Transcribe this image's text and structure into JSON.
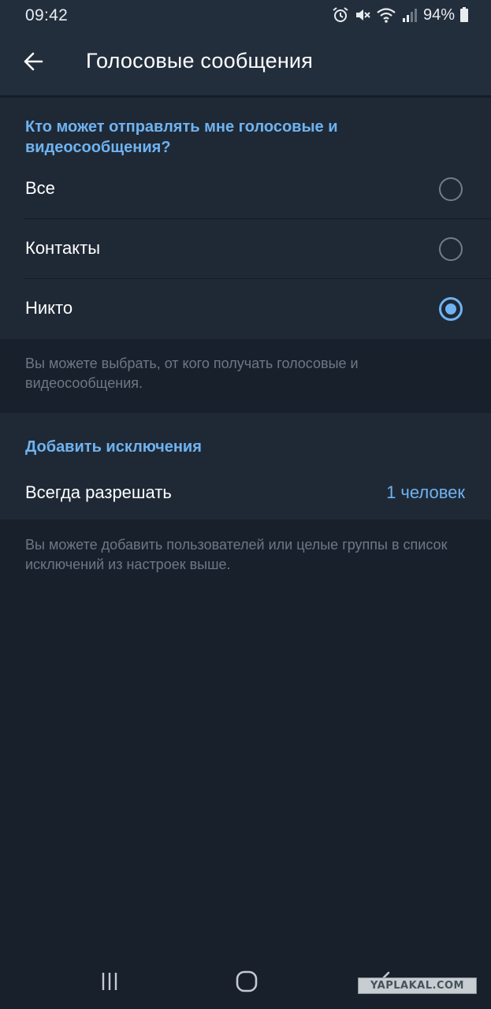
{
  "status_bar": {
    "time": "09:42",
    "battery": "94%",
    "icons": [
      "alarm-icon",
      "mute-icon",
      "wifi-icon",
      "signal-icon",
      "battery-icon"
    ]
  },
  "app_bar": {
    "title": "Голосовые сообщения",
    "back_icon": "arrow-left-icon"
  },
  "privacy": {
    "header": "Кто может отправлять мне голосовые и видеосообщения?",
    "options": [
      {
        "label": "Все",
        "selected": false
      },
      {
        "label": "Контакты",
        "selected": false
      },
      {
        "label": "Никто",
        "selected": true
      }
    ],
    "hint": "Вы можете выбрать, от кого получать голосовые и видеосообщения."
  },
  "exceptions": {
    "header": "Добавить исключения",
    "always_allow_label": "Всегда разрешать",
    "always_allow_value": "1 человек",
    "hint": "Вы можете добавить пользователей или целые группы в список исключений из настроек выше."
  },
  "nav_bar": {
    "icons": [
      "recent-apps-icon",
      "home-icon",
      "back-nav-icon"
    ]
  },
  "watermark": "YAPLAKAL.COM",
  "colors": {
    "background": "#18202b",
    "surface": "#1f2936",
    "header_bar": "#232e3c",
    "accent": "#6fb3f0",
    "hint_text": "#6d7885"
  }
}
